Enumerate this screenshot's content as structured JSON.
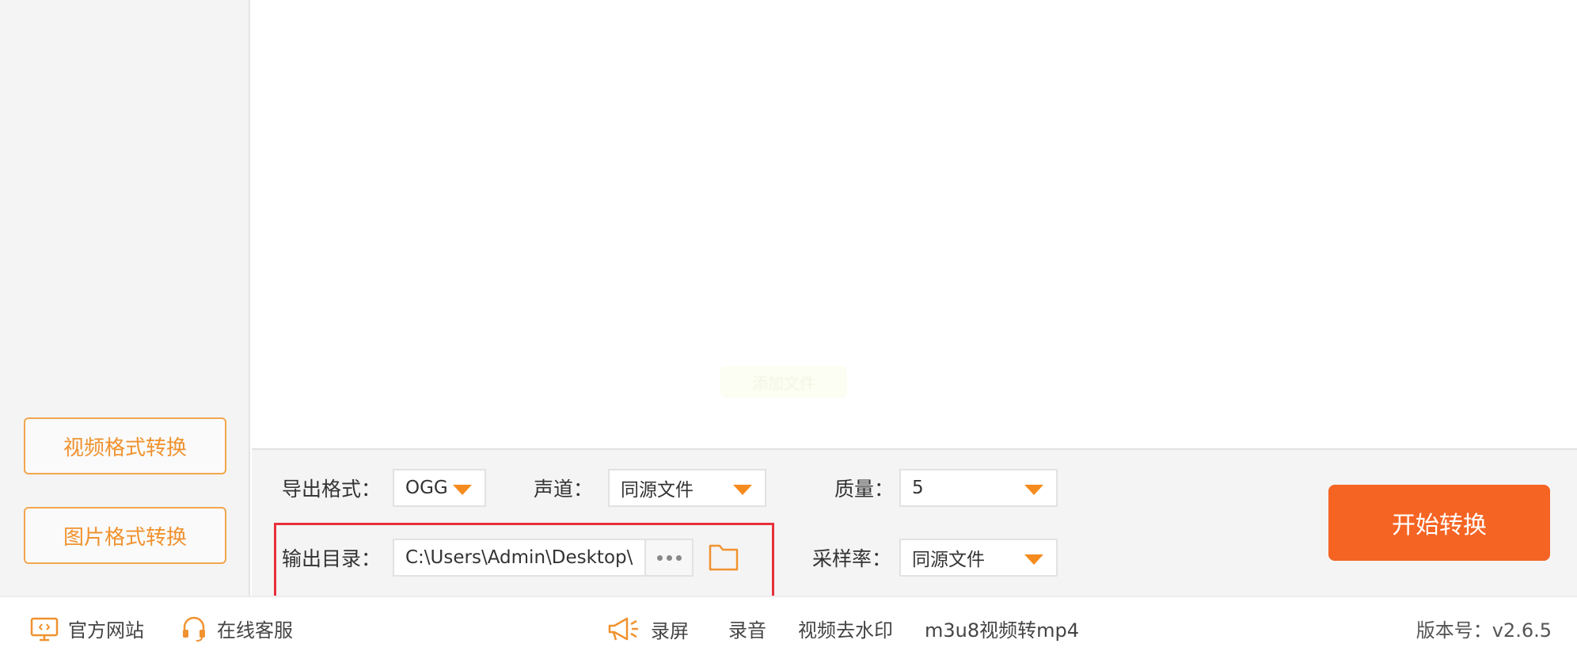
{
  "sidebar": {
    "video_convert_label": "视频格式转换",
    "image_convert_label": "图片格式转换"
  },
  "main": {
    "watermark_text": "添加文件"
  },
  "settings": {
    "export_format_label": "导出格式：",
    "export_format_value": "OGG",
    "channel_label": "声道：",
    "channel_value": "同源文件",
    "quality_label": "质量：",
    "quality_value": "5",
    "output_dir_label": "输出目录：",
    "output_dir_value": "C:\\Users\\Admin\\Desktop\\",
    "sample_rate_label": "采样率：",
    "sample_rate_value": "同源文件",
    "start_button_label": "开始转换"
  },
  "footer": {
    "official_site_label": "官方网站",
    "online_service_label": "在线客服",
    "record_screen_label": "录屏",
    "record_audio_label": "录音",
    "remove_watermark_label": "视频去水印",
    "m3u8_label": "m3u8视频转mp4",
    "version_text": "版本号：v2.6.5"
  },
  "colors": {
    "accent_orange": "#f56423",
    "outline_orange": "#f2a64f",
    "caret_orange": "#f58b1f",
    "highlight_red": "#e8303a"
  },
  "icons": {
    "official_site": "monitor-icon",
    "online_service": "headset-icon",
    "record_screen": "megaphone-icon",
    "folder": "folder-icon",
    "more": "ellipsis-icon",
    "dropdown": "caret-down-icon"
  }
}
